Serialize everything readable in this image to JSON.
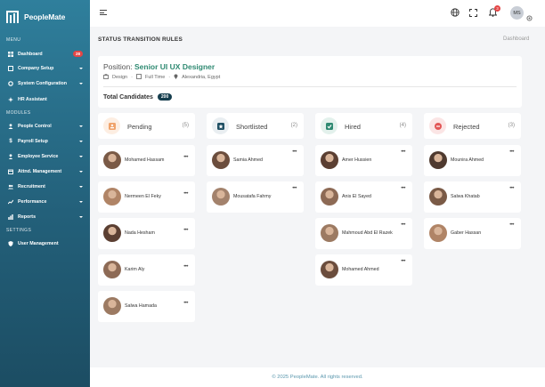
{
  "app": {
    "name": "PeopleMate"
  },
  "sidebar": {
    "menu_label": "MENU",
    "modules_label": "MODULES",
    "settings_label": "SETTINGS",
    "items": [
      {
        "label": "Dashboard",
        "badge": "28"
      },
      {
        "label": "Company Setup"
      },
      {
        "label": "System Configuration"
      },
      {
        "label": "HR Assistant"
      },
      {
        "label": "People Control"
      },
      {
        "label": "Payroll Setup"
      },
      {
        "label": "Employee Service"
      },
      {
        "label": "Attnd. Management"
      },
      {
        "label": "Recruitment"
      },
      {
        "label": "Performance"
      },
      {
        "label": "Reports"
      },
      {
        "label": "User Management"
      }
    ]
  },
  "topbar": {
    "notification_count": "3",
    "user_initials": "MS"
  },
  "page": {
    "title": "STATUS TRANSITION RULES",
    "breadcrumb": "Dashboard"
  },
  "job": {
    "position_prefix": "Position:",
    "position_title": "Senior UI UX Designer",
    "department": "Design",
    "employment_type": "Full Time",
    "location": "Alexandria, Egypt",
    "total_label": "Total Candidates",
    "total_count": "200"
  },
  "columns": [
    {
      "title": "Pending",
      "count": "(5)",
      "accent": "#f0a36b",
      "bg": "#fdeee2",
      "candidates": [
        "Mohamed Hassam",
        "Nermeen El Feky",
        "Nada Hesham",
        "Karim Aly",
        "Salwa Hamada"
      ]
    },
    {
      "title": "Shortlisted",
      "count": "(2)",
      "accent": "#1f4f63",
      "bg": "#e9eef1",
      "candidates": [
        "Samia Ahmed",
        "Mousatafa Fahmy"
      ]
    },
    {
      "title": "Hired",
      "count": "(4)",
      "accent": "#2f8a72",
      "bg": "#e3f1ec",
      "candidates": [
        "Amer Hussien",
        "Anis El Sayed",
        "Mahmoud Abd El Razek",
        "Mohamed Ahmed"
      ]
    },
    {
      "title": "Rejected",
      "count": "(3)",
      "accent": "#e25757",
      "bg": "#fbe5e5",
      "candidates": [
        "Mounira Ahmed",
        "Salwa Khatab",
        "Gaber Hassan"
      ]
    }
  ],
  "footer": {
    "text": "© 2025  PeopleMate. All rights reserved."
  }
}
